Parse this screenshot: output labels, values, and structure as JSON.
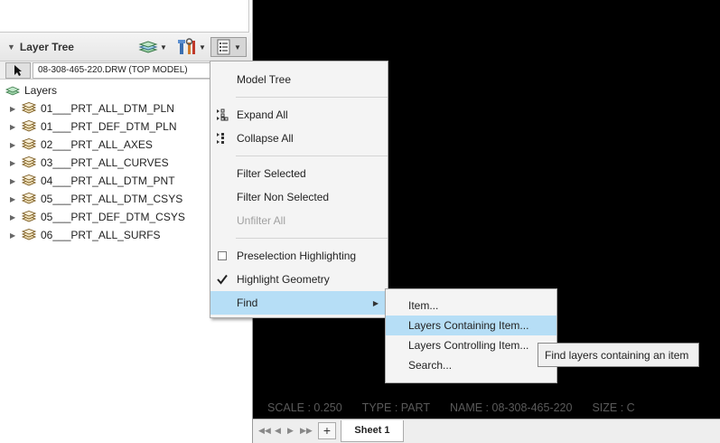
{
  "layer_tree": {
    "title": "Layer Tree",
    "model_select_value": "08-308-465-220.DRW (TOP MODEL)",
    "root_label": "Layers",
    "items": [
      "01___PRT_ALL_DTM_PLN",
      "01___PRT_DEF_DTM_PLN",
      "02___PRT_ALL_AXES",
      "03___PRT_ALL_CURVES",
      "04___PRT_ALL_DTM_PNT",
      "05___PRT_ALL_DTM_CSYS",
      "05___PRT_DEF_DTM_CSYS",
      "06___PRT_ALL_SURFS"
    ]
  },
  "header_icons": [
    "layers-icon",
    "tools-icon",
    "tree-settings-icon"
  ],
  "context_menu": {
    "model_tree": "Model Tree",
    "expand_all": "Expand All",
    "collapse_all": "Collapse All",
    "filter_selected": "Filter Selected",
    "filter_non_selected": "Filter Non Selected",
    "unfilter_all": "Unfilter All",
    "preselection_highlighting": "Preselection Highlighting",
    "preselection_checked": false,
    "highlight_geometry": "Highlight Geometry",
    "highlight_checked": true,
    "find": "Find"
  },
  "find_submenu": {
    "item": "Item...",
    "layers_containing": "Layers Containing Item...",
    "layers_controlling": "Layers Controlling Item...",
    "search": "Search..."
  },
  "tooltip": "Find layers containing an item",
  "status": {
    "scale": "SCALE : 0.250",
    "type": "TYPE : PART",
    "name": "NAME : 08-308-465-220",
    "size": "SIZE : C"
  },
  "sheet_bar": {
    "add_label": "+",
    "sheet_tab": "Sheet 1"
  },
  "colors": {
    "highlight": "#b6def6",
    "canvas": "#000000",
    "status_text": "#5a5a5a"
  }
}
